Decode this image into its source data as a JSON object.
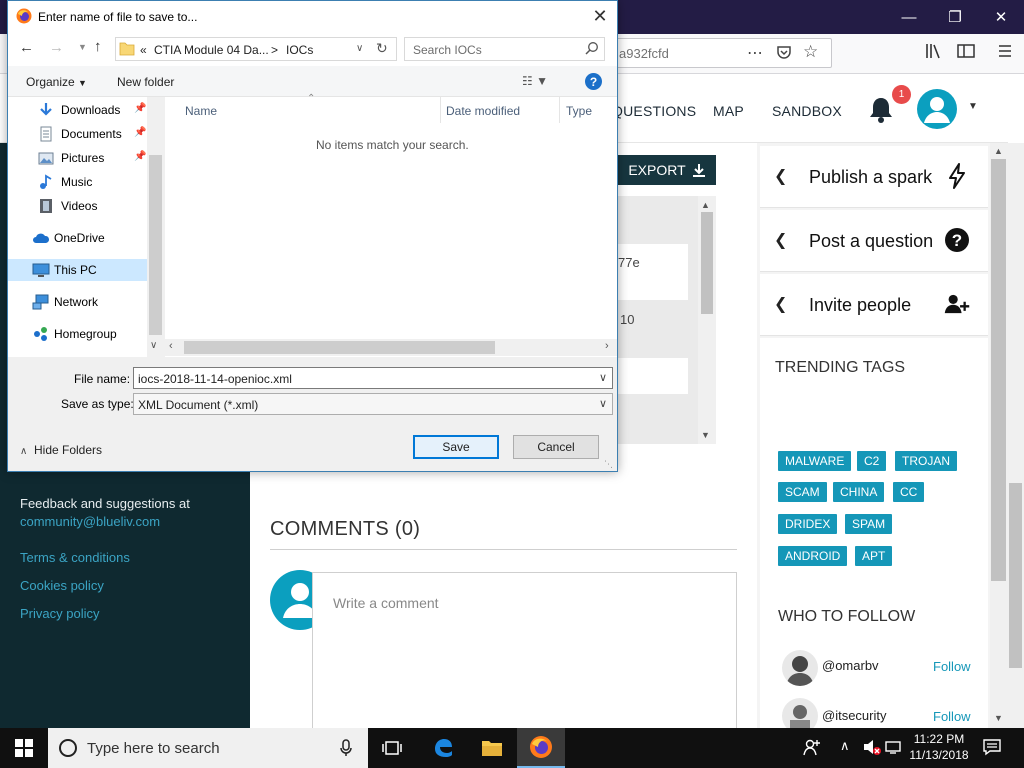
{
  "browser": {
    "url_fragment": "a932fcfd"
  },
  "site_nav": {
    "items": [
      "QUESTIONS",
      "MAP",
      "SANDBOX"
    ],
    "notification_count": "1"
  },
  "main": {
    "export_label": "EXPORT",
    "code_fragments": [
      "77e",
      "10"
    ],
    "comments_title": "COMMENTS (0)",
    "comment_placeholder": "Write a comment"
  },
  "sidebar": {
    "actions": [
      {
        "label": "Publish a spark",
        "icon": "lightning-icon"
      },
      {
        "label": "Post a question",
        "icon": "question-circle-icon"
      },
      {
        "label": "Invite people",
        "icon": "user-plus-icon"
      }
    ],
    "trending_title": "TRENDING TAGS",
    "tags": [
      "MALWARE",
      "C2",
      "TROJAN",
      "SCAM",
      "CHINA",
      "CC",
      "DRIDEX",
      "SPAM",
      "ANDROID",
      "APT"
    ],
    "follow_title": "WHO TO FOLLOW",
    "follow": [
      {
        "name": "@omarbv",
        "action": "Follow"
      },
      {
        "name": "@itsecurity",
        "action": "Follow"
      }
    ]
  },
  "footer": {
    "feedback_text": "Feedback and suggestions at",
    "feedback_email": "community@blueliv.com",
    "links": [
      "Terms & conditions",
      "Cookies policy",
      "Privacy policy"
    ]
  },
  "dialog": {
    "title": "Enter name of file to save to...",
    "breadcrumb": {
      "prefix": "«",
      "parent": "CTIA Module 04 Da...",
      "separator": ">",
      "current": "IOCs"
    },
    "search_placeholder": "Search IOCs",
    "organize_label": "Organize",
    "new_folder_label": "New folder",
    "nav_items": [
      {
        "label": "Downloads",
        "icon": "download-arrow-icon",
        "pinned": true
      },
      {
        "label": "Documents",
        "icon": "document-icon",
        "pinned": true
      },
      {
        "label": "Pictures",
        "icon": "picture-icon",
        "pinned": true
      },
      {
        "label": "Music",
        "icon": "music-note-icon",
        "pinned": false
      },
      {
        "label": "Videos",
        "icon": "film-icon",
        "pinned": false
      },
      {
        "label": "OneDrive",
        "icon": "cloud-icon",
        "pinned": false
      },
      {
        "label": "This PC",
        "icon": "computer-icon",
        "pinned": false,
        "selected": true
      },
      {
        "label": "Network",
        "icon": "network-icon",
        "pinned": false
      },
      {
        "label": "Homegroup",
        "icon": "homegroup-icon",
        "pinned": false
      }
    ],
    "columns": [
      "Name",
      "Date modified",
      "Type"
    ],
    "empty_message": "No items match your search.",
    "file_name_label": "File name:",
    "file_name_value": "iocs-2018-11-14-openioc.xml",
    "save_type_label": "Save as type:",
    "save_type_value": "XML Document (*.xml)",
    "hide_folders_label": "Hide Folders",
    "save_label": "Save",
    "cancel_label": "Cancel"
  },
  "taskbar": {
    "search_placeholder": "Type here to search",
    "time": "11:22 PM",
    "date": "11/13/2018"
  },
  "colors": {
    "accent": "#1597b8",
    "footer_bg": "#0f2930",
    "titlebar_bg": "#231c45",
    "export_bg": "#17363f"
  }
}
